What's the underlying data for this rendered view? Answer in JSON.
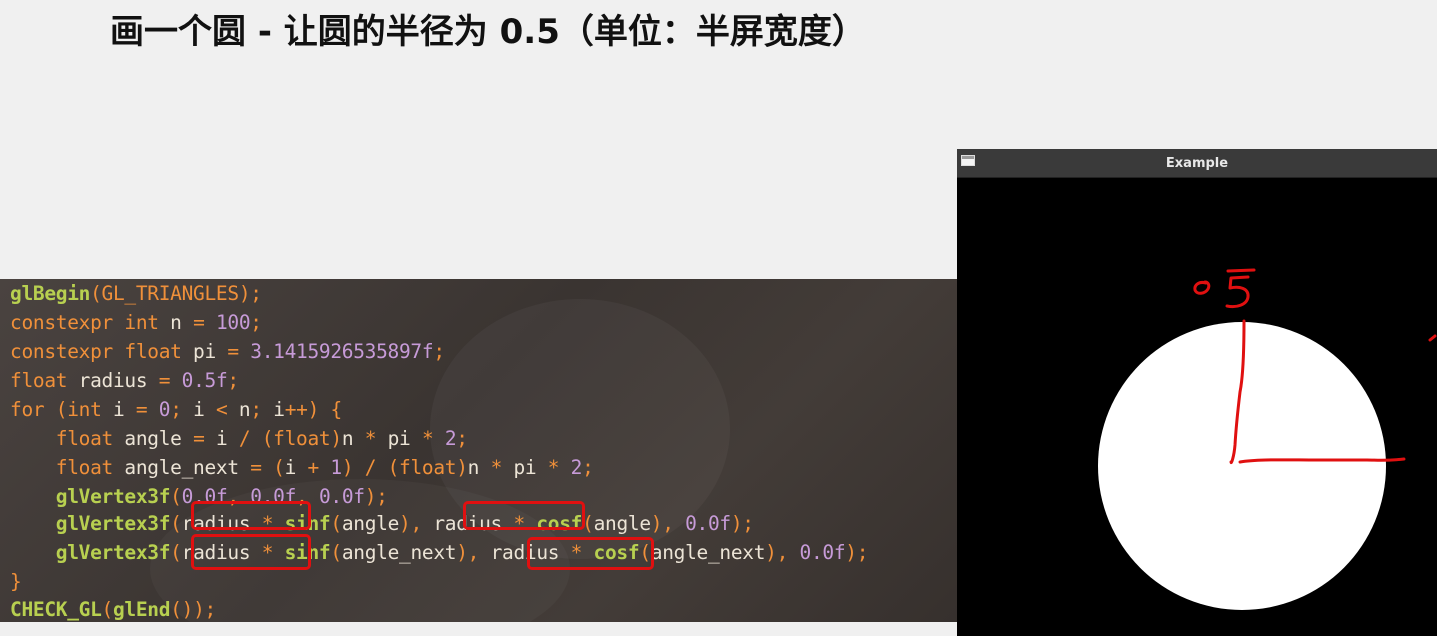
{
  "slide": {
    "title": "画一个圆 - 让圆的半径为 0.5（单位：半屏宽度）"
  },
  "code": {
    "lines": [
      [
        {
          "t": "glBegin",
          "c": "fn"
        },
        {
          "t": "(GL_TRIANGLES);",
          "c": "op"
        }
      ],
      [
        {
          "t": "constexpr int",
          "c": "kw"
        },
        {
          "t": " n ",
          "c": "txt"
        },
        {
          "t": "=",
          "c": "op"
        },
        {
          "t": " 100",
          "c": "num"
        },
        {
          "t": ";",
          "c": "op"
        }
      ],
      [
        {
          "t": "constexpr float",
          "c": "kw"
        },
        {
          "t": " pi ",
          "c": "txt"
        },
        {
          "t": "=",
          "c": "op"
        },
        {
          "t": " 3.1415926535897f",
          "c": "num"
        },
        {
          "t": ";",
          "c": "op"
        }
      ],
      [
        {
          "t": "float",
          "c": "kw"
        },
        {
          "t": " radius ",
          "c": "txt"
        },
        {
          "t": "=",
          "c": "op"
        },
        {
          "t": " 0.5f",
          "c": "num"
        },
        {
          "t": ";",
          "c": "op"
        }
      ],
      [
        {
          "t": "for",
          "c": "kw"
        },
        {
          "t": " (",
          "c": "op"
        },
        {
          "t": "int",
          "c": "kw"
        },
        {
          "t": " i ",
          "c": "txt"
        },
        {
          "t": "=",
          "c": "op"
        },
        {
          "t": " 0",
          "c": "num"
        },
        {
          "t": ";",
          "c": "op"
        },
        {
          "t": " i ",
          "c": "txt"
        },
        {
          "t": "<",
          "c": "op"
        },
        {
          "t": " n",
          "c": "txt"
        },
        {
          "t": ";",
          "c": "op"
        },
        {
          "t": " i",
          "c": "txt"
        },
        {
          "t": "++) {",
          "c": "op"
        }
      ],
      [
        {
          "t": "    float",
          "c": "kw"
        },
        {
          "t": " angle ",
          "c": "txt"
        },
        {
          "t": "=",
          "c": "op"
        },
        {
          "t": " i ",
          "c": "txt"
        },
        {
          "t": "/ (",
          "c": "op"
        },
        {
          "t": "float",
          "c": "kw"
        },
        {
          "t": ")",
          "c": "op"
        },
        {
          "t": "n ",
          "c": "txt"
        },
        {
          "t": "*",
          "c": "op"
        },
        {
          "t": " pi ",
          "c": "txt"
        },
        {
          "t": "*",
          "c": "op"
        },
        {
          "t": " 2",
          "c": "num"
        },
        {
          "t": ";",
          "c": "op"
        }
      ],
      [
        {
          "t": "    float",
          "c": "kw"
        },
        {
          "t": " angle_next ",
          "c": "txt"
        },
        {
          "t": "= (",
          "c": "op"
        },
        {
          "t": "i ",
          "c": "txt"
        },
        {
          "t": "+",
          "c": "op"
        },
        {
          "t": " 1",
          "c": "num"
        },
        {
          "t": ") / (",
          "c": "op"
        },
        {
          "t": "float",
          "c": "kw"
        },
        {
          "t": ")",
          "c": "op"
        },
        {
          "t": "n ",
          "c": "txt"
        },
        {
          "t": "*",
          "c": "op"
        },
        {
          "t": " pi ",
          "c": "txt"
        },
        {
          "t": "*",
          "c": "op"
        },
        {
          "t": " 2",
          "c": "num"
        },
        {
          "t": ";",
          "c": "op"
        }
      ],
      [
        {
          "t": "    glVertex3f",
          "c": "fn"
        },
        {
          "t": "(",
          "c": "op"
        },
        {
          "t": "0.0f",
          "c": "num"
        },
        {
          "t": ", ",
          "c": "op"
        },
        {
          "t": "0.0f",
          "c": "num"
        },
        {
          "t": ", ",
          "c": "op"
        },
        {
          "t": "0.0f",
          "c": "num"
        },
        {
          "t": ");",
          "c": "op"
        }
      ],
      [
        {
          "t": "    glVertex3f",
          "c": "fn"
        },
        {
          "t": "(",
          "c": "op"
        },
        {
          "t": "radius ",
          "c": "txt"
        },
        {
          "t": "*",
          "c": "op"
        },
        {
          "t": " sinf",
          "c": "fn"
        },
        {
          "t": "(",
          "c": "op"
        },
        {
          "t": "angle",
          "c": "txt"
        },
        {
          "t": "), ",
          "c": "op"
        },
        {
          "t": "radius ",
          "c": "txt"
        },
        {
          "t": "*",
          "c": "op"
        },
        {
          "t": " cosf",
          "c": "fn"
        },
        {
          "t": "(",
          "c": "op"
        },
        {
          "t": "angle",
          "c": "txt"
        },
        {
          "t": "), ",
          "c": "op"
        },
        {
          "t": "0.0f",
          "c": "num"
        },
        {
          "t": ");",
          "c": "op"
        }
      ],
      [
        {
          "t": "    glVertex3f",
          "c": "fn"
        },
        {
          "t": "(",
          "c": "op"
        },
        {
          "t": "radius ",
          "c": "txt"
        },
        {
          "t": "*",
          "c": "op"
        },
        {
          "t": " sinf",
          "c": "fn"
        },
        {
          "t": "(",
          "c": "op"
        },
        {
          "t": "angle_next",
          "c": "txt"
        },
        {
          "t": "), ",
          "c": "op"
        },
        {
          "t": "radius ",
          "c": "txt"
        },
        {
          "t": "*",
          "c": "op"
        },
        {
          "t": " cosf",
          "c": "fn"
        },
        {
          "t": "(",
          "c": "op"
        },
        {
          "t": "angle_next",
          "c": "txt"
        },
        {
          "t": "), ",
          "c": "op"
        },
        {
          "t": "0.0f",
          "c": "num"
        },
        {
          "t": ");",
          "c": "op"
        }
      ],
      [
        {
          "t": "}",
          "c": "op"
        }
      ],
      [
        {
          "t": "CHECK_GL",
          "c": "fn"
        },
        {
          "t": "(",
          "c": "op"
        },
        {
          "t": "glEnd",
          "c": "fn"
        },
        {
          "t": "());",
          "c": "op"
        }
      ]
    ]
  },
  "window": {
    "title": "Example",
    "annotation": "05"
  },
  "colors": {
    "annotation_red": "#e01010",
    "circle": "#ffffff",
    "canvas_bg": "#000000"
  }
}
